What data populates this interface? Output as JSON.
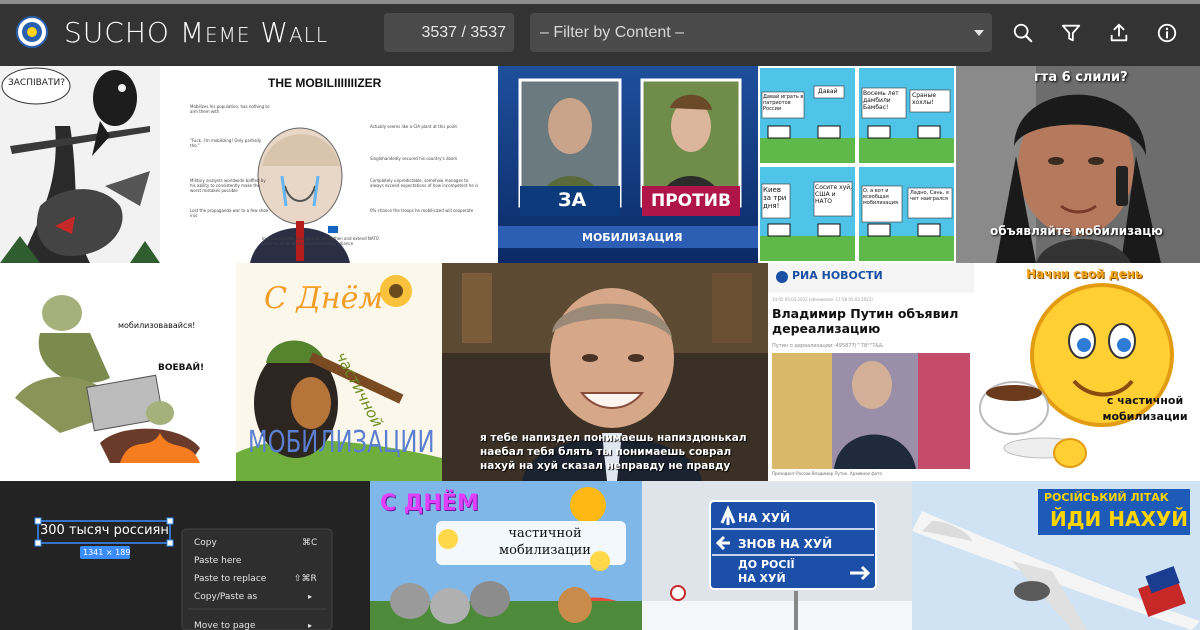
{
  "header": {
    "title": "SUCHO Meme Wall",
    "counter": "3537 / 3537",
    "filter_placeholder": "– Filter by Content –"
  },
  "tools": [
    {
      "icon": "search-icon"
    },
    {
      "icon": "filter-icon"
    },
    {
      "icon": "upload-icon"
    },
    {
      "icon": "info-icon"
    }
  ],
  "tiles": {
    "mobilizer": {
      "bubble": "ЗАСПІВАТИ?",
      "title": "THE MOBILIIIIIIIZER",
      "left_notes": [
        "Mobilizes his population, has nothing to arm them with",
        "\"Fuck, I'm mobilizing! Only partially tho.\"",
        "Military analysts worldwide baffled by his ability to consistently make the worst mistakes possible",
        "Lost the propaganda war to a few shoe irus",
        "In a few months managed to strengthen and extend NATO borders, while destroying his military alliance"
      ],
      "right_notes": [
        "Actually seems like a CIA plant at this point",
        "Singlehandedly secured his country's doom",
        "Completely unpredictable, somehow manages to always exceed expectations of how incompetent he is",
        "0% chance the troops he mobilisized will cooperate"
      ]
    },
    "za_protiv": {
      "for": "ЗА",
      "against": "ПРОТИВ",
      "banner": "МОБИЛИЗАЦИЯ"
    },
    "zebras": {
      "panels": [
        [
          "Давай играть в патриотов России",
          "Давай"
        ],
        [
          "Восемь лет дамбили Бамбас!",
          "Сраные хохлы!"
        ],
        [
          "Киев за три дня!",
          "Сосите хуй, США и НАТО"
        ],
        [
          "О, а вот и всеобщая мобилизация",
          "Ладно, Сань, я чет наигрался"
        ]
      ]
    },
    "phone": {
      "top": "гта 6 слили?",
      "bottom": "объявляйте мобилизацю"
    },
    "military": {
      "shout1": "мобилизовавайся!",
      "shout2": "ВОЕВАЙ!"
    },
    "dog_card": {
      "line1": "С Днём",
      "line2": "частичной",
      "line3": "МОБИЛИЗАЦИИ"
    },
    "putin_smile": {
      "caption": "я тебе напиздел понимаешь напиздюнькал наебал тебя блять ты понимаешь соврал нахуй на хуй сказал неправду не правду"
    },
    "ria": {
      "brand": "РИА НОВОСТИ",
      "meta": "14:45 05.03.2022 (обновлено: 17:58 05.03.2022)",
      "headline": "Владимир Путин объявил дереализацию",
      "sub": "Путин о дереализации: 495877(^78°\"7&&",
      "photo_caption": "Президент России Владимир Путин. Архивное фото"
    },
    "emoji": {
      "top": "Начни свой день",
      "bottom": "с частичной мобилизации"
    },
    "context_menu": {
      "selection": "300 тысяч россиян",
      "size": "1341 × 189",
      "items": [
        {
          "label": "Copy",
          "shortcut": "⌘C"
        },
        {
          "label": "Paste here",
          "shortcut": ""
        },
        {
          "label": "Paste to replace",
          "shortcut": "⇧⌘R"
        },
        {
          "label": "Copy/Paste as",
          "shortcut": "▸"
        },
        {
          "label": "Move to page",
          "shortcut": "▸"
        }
      ]
    },
    "card2": {
      "line1": "С ДНЁМ",
      "line2": "частичной мобилизации"
    },
    "road_sign": {
      "row1": "НА ХУЙ",
      "row2": "ЗНОВ НА ХУЙ",
      "row3a": "ДО РОСІЇ",
      "row3b": "НА ХУЙ"
    },
    "plane": {
      "line1": "РОСІЙСЬКИЙ ЛІТАК",
      "line2": "ЙДИ НАХУЙ"
    }
  }
}
